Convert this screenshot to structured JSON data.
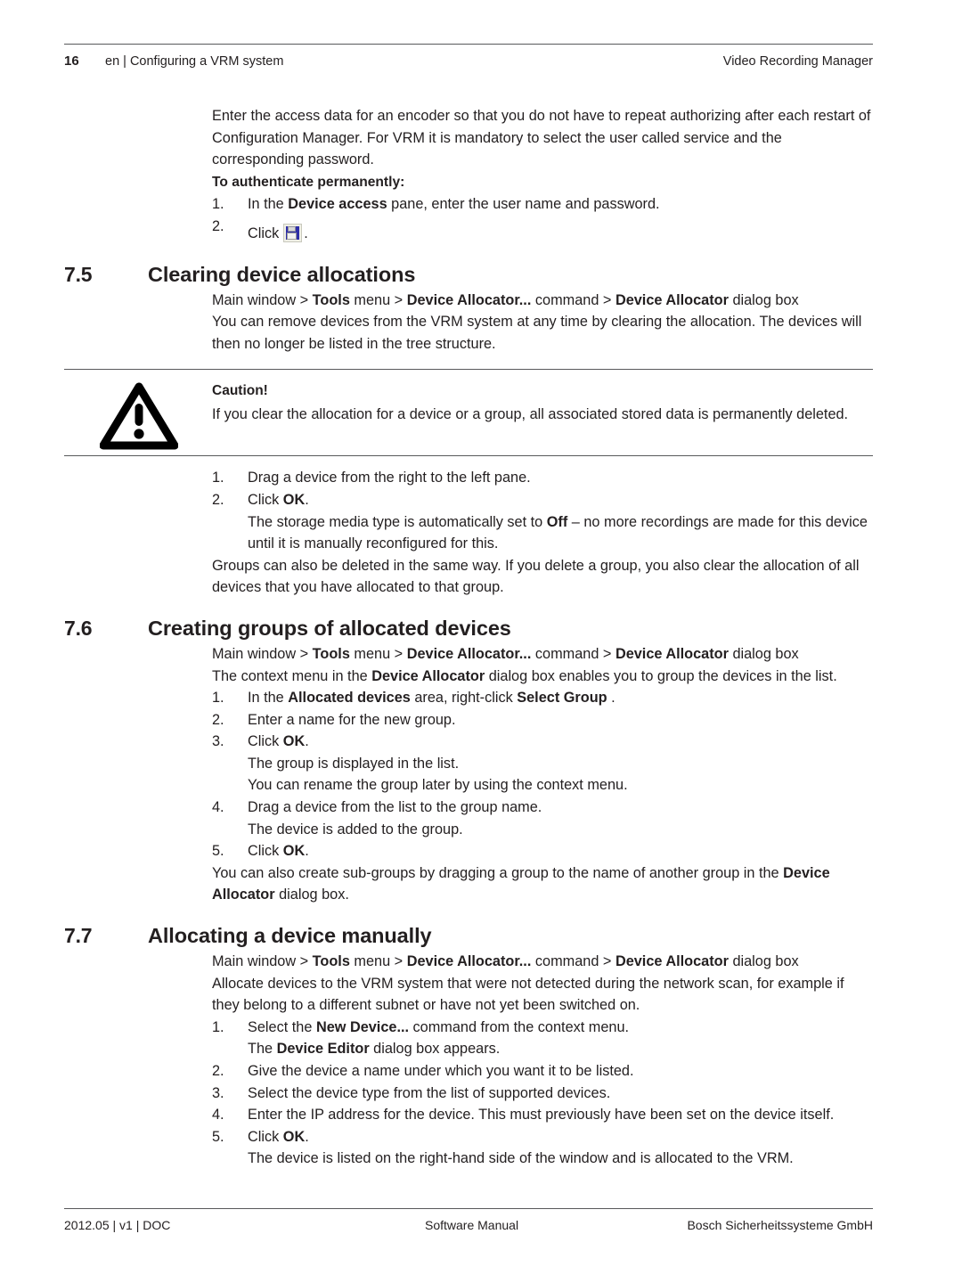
{
  "header": {
    "page_number": "16",
    "left_text": "en | Configuring a VRM system",
    "right_text": "Video Recording Manager"
  },
  "footer": {
    "left": "2012.05 | v1 | DOC",
    "center": "Software Manual",
    "right": "Bosch Sicherheitssysteme GmbH"
  },
  "intro": {
    "paragraph_1": "Enter the access data for an encoder so that you do not have to repeat authorizing after each restart of Configuration Manager. For VRM it is mandatory to select the user called service and the corresponding password.",
    "subheading": "To authenticate permanently:",
    "step_1_num": "1.",
    "step_1_a": "In the ",
    "step_1_b": "Device access",
    "step_1_c": " pane, enter the user name and password.",
    "step_2_num": "2.",
    "step_2_a": "Click",
    "step_2_icon": "save-icon",
    "step_2_c": "."
  },
  "sections": [
    {
      "number": "7.5",
      "title": "Clearing device allocations",
      "breadcrumb": {
        "p1": "Main window > ",
        "b1": "Tools",
        "p2": " menu > ",
        "b2": "Device Allocator...",
        "p3": " command > ",
        "b3": "Device Allocator",
        "p4": " dialog box"
      },
      "body": "You can remove devices from the VRM system at any time by clearing the allocation. The devices will then no longer be listed in the tree structure.",
      "caution": {
        "icon": "warning-triangle-icon",
        "title": "Caution!",
        "text": "If you clear the allocation for a device or a group, all associated stored data is permanently deleted."
      },
      "steps": [
        {
          "num": "1.",
          "text": "Drag a device from the right to the left pane."
        },
        {
          "num": "2.",
          "pre": "Click ",
          "bold": "OK",
          "post": "."
        }
      ],
      "step_2_sub_a": "The storage media type is automatically set to ",
      "step_2_sub_b": "Off",
      "step_2_sub_c": " – no more recordings are made for this device until it is manually reconfigured for this.",
      "closing": "Groups can also be deleted in the same way. If you delete a group, you also clear the allocation of all devices that you have allocated to that group."
    },
    {
      "number": "7.6",
      "title": "Creating groups of allocated devices",
      "breadcrumb": {
        "p1": "Main window > ",
        "b1": "Tools",
        "p2": " menu > ",
        "b2": "Device Allocator...",
        "p3": " command > ",
        "b3": "Device Allocator",
        "p4": " dialog box"
      },
      "body_a": "The context menu in the ",
      "body_b": "Device Allocator",
      "body_c": " dialog box enables you to group the devices in the list.",
      "step_1_num": "1.",
      "step_1_a": "In the ",
      "step_1_b": "Allocated devices",
      "step_1_c": " area, right-click ",
      "step_1_d": "Select Group",
      "step_1_e": " .",
      "step_2_num": "2.",
      "step_2_text": "Enter a name for the new group.",
      "step_3_num": "3.",
      "step_3_pre": "Click ",
      "step_3_bold": "OK",
      "step_3_post": ".",
      "step_3_sub_1": "The group is displayed in the list.",
      "step_3_sub_2": "You can rename the group later by using the context menu.",
      "step_4_num": "4.",
      "step_4_text": "Drag a device from the list to the group name.",
      "step_4_sub": "The device is added to the group.",
      "step_5_num": "5.",
      "step_5_pre": "Click ",
      "step_5_bold": "OK",
      "step_5_post": ".",
      "closing_a": "You can also create sub-groups by dragging a group to the name of another group in the ",
      "closing_b": "Device Allocator",
      "closing_c": " dialog box."
    },
    {
      "number": "7.7",
      "title": "Allocating a device manually",
      "breadcrumb": {
        "p1": "Main window > ",
        "b1": "Tools",
        "p2": " menu > ",
        "b2": "Device Allocator...",
        "p3": " command > ",
        "b3": "Device Allocator",
        "p4": " dialog box"
      },
      "body": "Allocate devices to the VRM system that were not detected during the network scan, for example if they belong to a different subnet or have not yet been switched on.",
      "step_1_num": "1.",
      "step_1_a": "Select the ",
      "step_1_b": "New Device...",
      "step_1_c": " command from the context menu.",
      "step_1_sub_a": "The ",
      "step_1_sub_b": "Device Editor",
      "step_1_sub_c": " dialog box appears.",
      "step_2_num": "2.",
      "step_2_text": "Give the device a name under which you want it to be listed.",
      "step_3_num": "3.",
      "step_3_text": "Select the device type from the list of supported devices.",
      "step_4_num": "4.",
      "step_4_text": "Enter the IP address for the device. This must previously have been set on the device itself.",
      "step_5_num": "5.",
      "step_5_pre": "Click ",
      "step_5_bold": "OK",
      "step_5_post": ".",
      "step_5_sub": "The device is listed on the right-hand side of the window and is allocated to the VRM."
    }
  ],
  "colors": {
    "text": "#231f20",
    "rule": "#58595b",
    "floppy_blue": "#2e2ea8"
  }
}
